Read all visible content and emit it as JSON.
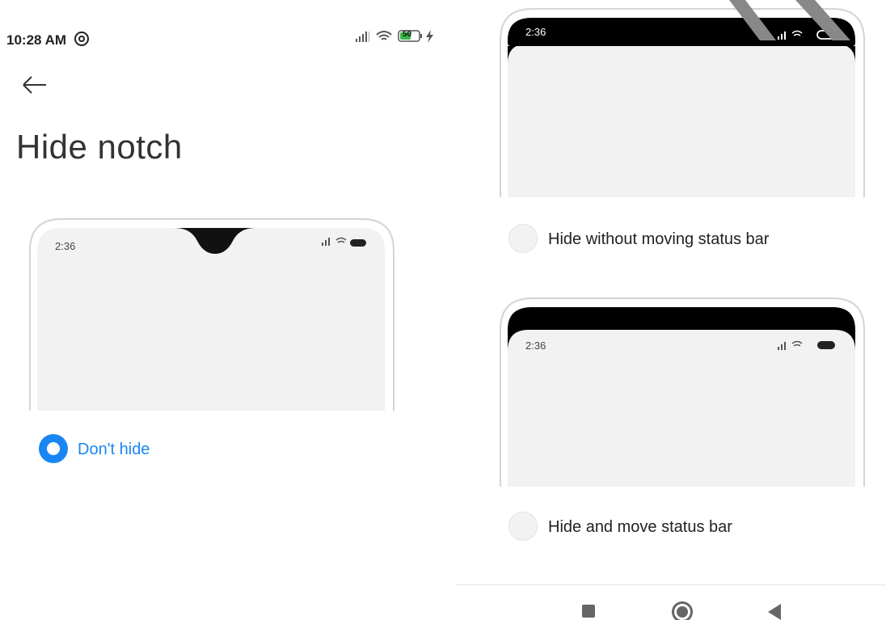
{
  "status_bar": {
    "time": "10:28 AM",
    "battery": "50"
  },
  "page": {
    "title": "Hide notch"
  },
  "previews": {
    "time": "2:36"
  },
  "options": [
    {
      "label": "Don't hide",
      "selected": true
    },
    {
      "label": "Hide without moving status bar",
      "selected": false
    },
    {
      "label": "Hide and move status bar",
      "selected": false
    }
  ],
  "colors": {
    "accent": "#1a86f4",
    "preview_screen": "#f2f2f2"
  },
  "nav_bar": {
    "icons": [
      "recents-square-icon",
      "home-circle-icon",
      "back-triangle-icon"
    ]
  }
}
